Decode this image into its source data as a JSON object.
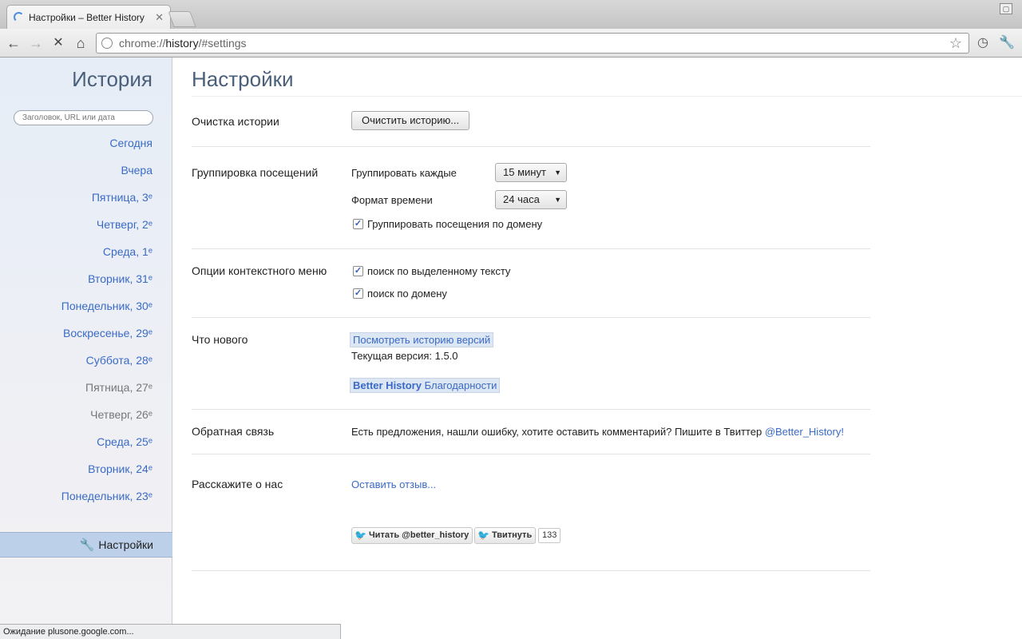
{
  "browser": {
    "tab_title": "Настройки – Better History",
    "tab_close": "✕",
    "url_scheme": "chrome://",
    "url_host": "history",
    "url_path": "/#settings"
  },
  "sidebar": {
    "title": "История",
    "search_placeholder": "Заголовок, URL или дата",
    "items": [
      {
        "label": "Сегодня",
        "dim": false
      },
      {
        "label": "Вчера",
        "dim": false
      },
      {
        "label": "Пятница, 3ᵉ",
        "dim": false
      },
      {
        "label": "Четверг, 2ᵉ",
        "dim": false
      },
      {
        "label": "Среда, 1ᵉ",
        "dim": false
      },
      {
        "label": "Вторник, 31ᵉ",
        "dim": false
      },
      {
        "label": "Понедельник, 30ᵉ",
        "dim": false
      },
      {
        "label": "Воскресенье, 29ᵉ",
        "dim": false
      },
      {
        "label": "Суббота, 28ᵉ",
        "dim": false
      },
      {
        "label": "Пятница, 27ᵉ",
        "dim": true
      },
      {
        "label": "Четверг, 26ᵉ",
        "dim": true
      },
      {
        "label": "Среда, 25ᵉ",
        "dim": false
      },
      {
        "label": "Вторник, 24ᵉ",
        "dim": false
      },
      {
        "label": "Понедельник, 23ᵉ",
        "dim": false
      }
    ],
    "settings_label": "Настройки"
  },
  "main": {
    "title": "Настройки",
    "clear": {
      "label": "Очистка истории",
      "button": "Очистить историю..."
    },
    "grouping": {
      "label": "Группировка посещений",
      "group_every_label": "Группировать каждые",
      "group_every_value": "15 минут",
      "time_format_label": "Формат времени",
      "time_format_value": "24 часа",
      "group_by_domain": "Группировать посещения по домену",
      "group_by_domain_checked": true
    },
    "context_menu": {
      "label": "Опции контекстного меню",
      "search_selected": "поиск по выделенному тексту",
      "search_domain": "поиск по домену"
    },
    "whats_new": {
      "label": "Что нового",
      "version_history_link": "Посмотреть историю версий",
      "current_version": "Текущая версия: 1.5.0",
      "credits_brand": "Better History",
      "credits_text": "Благодарности"
    },
    "feedback": {
      "label": "Обратная связь",
      "text": "Есть предложения, нашли ошибку, хотите оставить комментарий? Пишите в Твиттер",
      "handle": "@Better_History!"
    },
    "tell_others": {
      "label": "Расскажите о нас",
      "review_link": "Оставить отзыв...",
      "follow_button": "Читать @better_history",
      "tweet_button": "Твитнуть",
      "tweet_count": "133"
    }
  },
  "status_bar": "Ожидание plusone.google.com..."
}
